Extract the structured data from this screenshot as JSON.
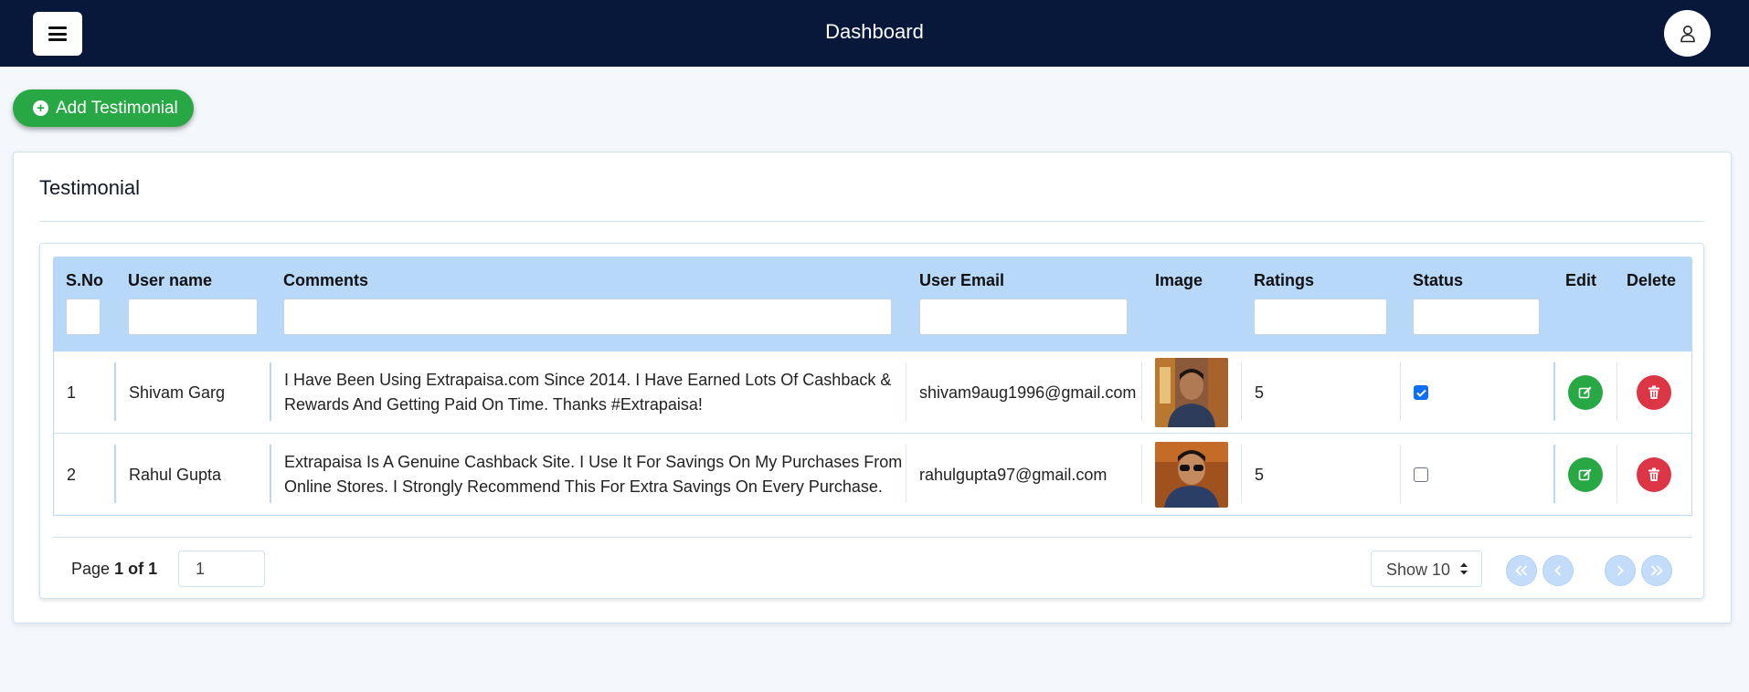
{
  "header": {
    "title": "Dashboard"
  },
  "actions": {
    "add_label": "Add Testimonial"
  },
  "card": {
    "title": "Testimonial"
  },
  "table": {
    "columns": [
      "S.No",
      "User name",
      "Comments",
      "User Email",
      "Image",
      "Ratings",
      "Status",
      "Edit",
      "Delete"
    ],
    "rows": [
      {
        "sno": "1",
        "user_name": "Shivam Garg",
        "comment_line1": "I Have Been Using Extrapaisa.com Since 2014. I Have Earned Lots Of Cashback &",
        "comment_line2": "Rewards And Getting Paid On Time. Thanks #Extrapaisa!",
        "email": "shivam9aug1996@gmail.com",
        "image": "user-photo",
        "rating": "5",
        "status_checked": true
      },
      {
        "sno": "2",
        "user_name": "Rahul Gupta",
        "comment_line1": "Extrapaisa Is A Genuine Cashback Site. I Use It For Savings On My Purchases From",
        "comment_line2": "Online Stores. I Strongly Recommend This For Extra Savings On Every Purchase.",
        "email": "rahulgupta97@gmail.com",
        "image": "user-photo",
        "rating": "5",
        "status_checked": false
      }
    ]
  },
  "pagination": {
    "page_prefix": "Page",
    "page_current_of_total": "1 of 1",
    "page_input_value": "1",
    "show_label": "Show 10"
  },
  "colors": {
    "topbar": "#07183a",
    "add_button": "#27a844",
    "table_header": "#b8d8fa",
    "edit_button": "#27a844",
    "delete_button": "#dc3545",
    "pagination_button": "#c3dcfa"
  },
  "icons": {
    "menu": "hamburger-menu-icon",
    "user": "user-icon",
    "add": "plus-circle-icon",
    "edit": "edit-icon",
    "delete": "trash-icon",
    "first": "double-chevron-left-icon",
    "prev": "chevron-left-icon",
    "next": "chevron-right-icon",
    "last": "double-chevron-right-icon"
  }
}
